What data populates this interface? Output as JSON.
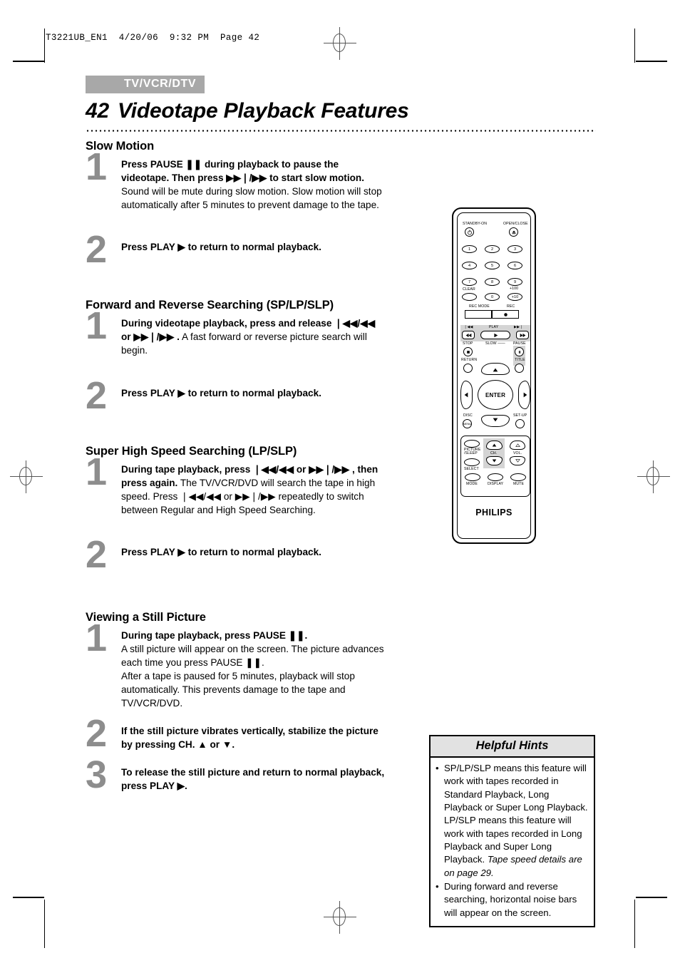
{
  "print_header": "T3221UB_EN1  4/20/06  9:32 PM  Page 42",
  "kicker": "TV/VCR/DTV",
  "title": {
    "page_number": "42",
    "text": "Videotape Playback Features"
  },
  "sections": [
    {
      "heading": "Slow Motion",
      "steps": [
        {
          "num": "1",
          "html": "<b>Press PAUSE ❚❚ during playback to pause the videotape. Then press ▶▶❘/▶▶ to start slow motion.</b> Sound will be mute during slow motion. Slow motion will stop automatically after 5 minutes to prevent damage to the tape."
        },
        {
          "num": "2",
          "html": "<b>Press PLAY ▶ to return to normal playback.</b>"
        }
      ]
    },
    {
      "heading": "Forward and Reverse Searching (SP/LP/SLP)",
      "steps": [
        {
          "num": "1",
          "html": "<b>During videotape playback, press and release ❘◀◀/◀◀ or ▶▶❘/▶▶ .</b> A fast forward or reverse picture search will begin."
        },
        {
          "num": "2",
          "html": "<b>Press PLAY ▶ to return to normal playback.</b>"
        }
      ]
    },
    {
      "heading": "Super High Speed Searching (LP/SLP)",
      "steps": [
        {
          "num": "1",
          "html": "<b>During tape playback, press ❘◀◀/◀◀ or ▶▶❘/▶▶ , then press again.</b> The TV/VCR/DVD will search the tape in high speed. Press ❘◀◀/◀◀ or ▶▶❘/▶▶ repeatedly to switch between Regular and High Speed Searching."
        },
        {
          "num": "2",
          "html": "<b>Press PLAY ▶ to return to normal playback.</b>"
        }
      ]
    },
    {
      "heading": "Viewing a Still Picture",
      "steps": [
        {
          "num": "1",
          "html": "<b>During tape playback, press PAUSE ❚❚.</b><br>A still picture will appear on the screen. The picture advances each time you press PAUSE ❚❚.<br>After a tape is paused for 5 minutes, playback will stop automatically. This prevents damage to the tape and TV/VCR/DVD."
        },
        {
          "num": "2",
          "html": "<b>If the still picture vibrates vertically, stabilize the picture by pressing CH. ▲ or ▼.</b>"
        },
        {
          "num": "3",
          "html": "<b>To release the still picture and return to normal playback, press PLAY ▶.</b>"
        }
      ]
    }
  ],
  "helpful_hints": {
    "title": "Helpful Hints",
    "items": [
      {
        "bullet": "•",
        "html": "SP/LP/SLP means this feature will work with tapes recorded in Standard Playback, Long Playback or Super Long Playback. LP/SLP means this feature will work with tapes recorded in Long Playback and Super Long Playback. <i>Tape speed details are on page 29.</i>"
      },
      {
        "bullet": "•",
        "html": "During forward and reverse searching, horizontal noise bars will appear on the screen."
      }
    ]
  },
  "remote": {
    "brand": "PHILIPS",
    "labels": {
      "standby": "STANDBY-ON",
      "open_close": "OPEN/CLOSE",
      "clear": "CLEAR",
      "plus100": "+100",
      "rec_mode": "REC MODE",
      "rec": "REC",
      "play": "PLAY",
      "prev": "❘◀◀",
      "next": "▶▶❘",
      "stop": "STOP",
      "slow": "SLOW ——",
      "pause": "PAUSE",
      "return": "RETURN",
      "title": "TITLE",
      "enter": "ENTER",
      "disc": "DISC",
      "setup": "SET-UP",
      "picture_sleep": "PICTURE\n/SLEEP",
      "select": "SELECT",
      "ch": "CH.",
      "vol": "VOL.",
      "mode": "MODE",
      "display": "DISPLAY",
      "mute": "MUTE"
    },
    "keys": [
      "1",
      "2",
      "3",
      "4",
      "5",
      "6",
      "7",
      "8",
      "9",
      "0",
      "+10"
    ]
  }
}
